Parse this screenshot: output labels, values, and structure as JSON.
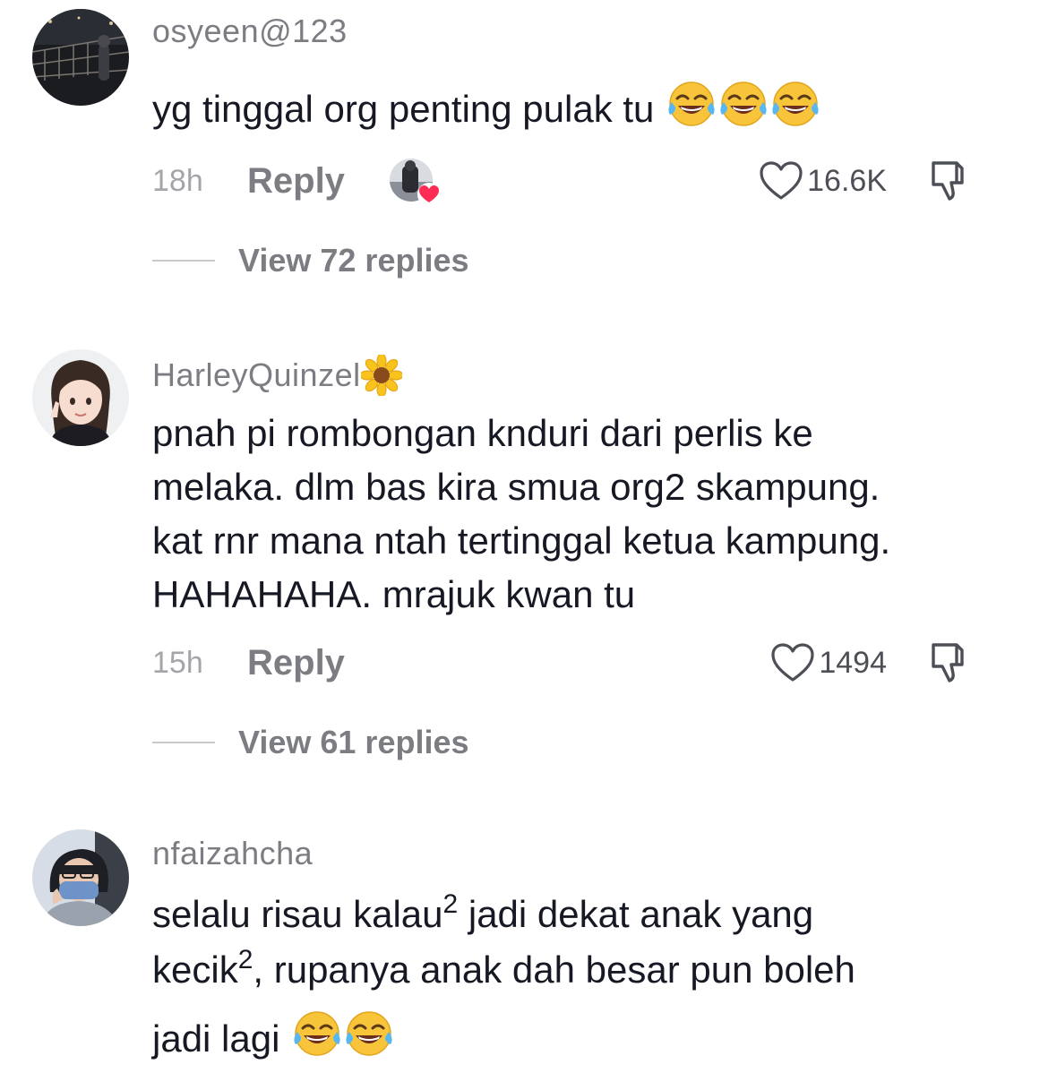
{
  "comments": [
    {
      "username": "osyeen@123",
      "text": "yg tinggal org penting pulak tu",
      "emoji": [
        "face-with-tears-of-joy",
        "face-with-tears-of-joy",
        "face-with-tears-of-joy"
      ],
      "time": "18h",
      "reply_label": "Reply",
      "creator_liked": true,
      "likes": "16.6K",
      "view_replies": "View 72 replies"
    },
    {
      "username": "HarleyQuinzel",
      "username_emoji": "sunflower",
      "text_lines": [
        "pnah pi rombongan knduri dari perlis ke",
        "melaka. dlm bas kira smua org2 skampung.",
        "kat rnr mana ntah tertinggal ketua kampung.",
        "HAHAHAHA. mrajuk kwan tu"
      ],
      "time": "15h",
      "reply_label": "Reply",
      "likes": "1494",
      "view_replies": "View 61 replies"
    },
    {
      "username": "nfaizahcha",
      "text_part1": "selalu risau kalau",
      "sup1": "2",
      "text_part2": " jadi dekat anak yang",
      "text_part3": "kecik",
      "sup2": "2",
      "text_part4": ", rupanya anak dah besar pun boleh",
      "text_part5": "jadi lagi",
      "emoji": [
        "face-with-tears-of-joy",
        "face-with-tears-of-joy"
      ]
    }
  ],
  "colors": {
    "text": "#161823",
    "secondary": "#7c7d82",
    "time": "#a4a5a9",
    "heart_red": "#fe2c55"
  }
}
